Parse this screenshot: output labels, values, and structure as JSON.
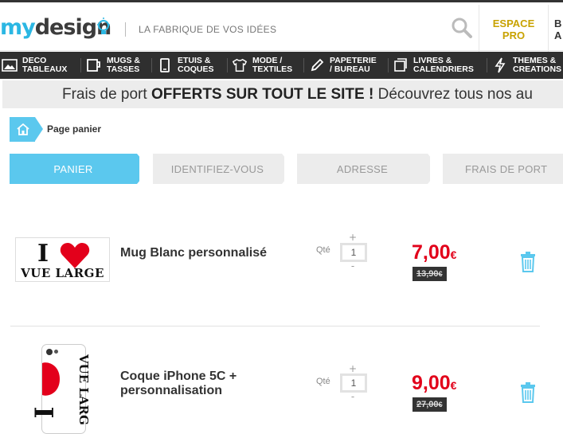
{
  "header": {
    "logo_my": "my",
    "logo_design": "design",
    "tagline": "LA FABRIQUE DE VOS IDÉES",
    "pro_line1": "ESPACE",
    "pro_line2": "PRO",
    "right_fragment_line1": "B",
    "right_fragment_line2": "A"
  },
  "nav": [
    {
      "line1": "DECO",
      "line2": "TABLEAUX",
      "icon": "frame-icon"
    },
    {
      "line1": "MUGS &",
      "line2": "TASSES",
      "icon": "mug-icon"
    },
    {
      "line1": "ETUIS &",
      "line2": "COQUES",
      "icon": "phone-icon"
    },
    {
      "line1": "MODE /",
      "line2": "TEXTILES",
      "icon": "tshirt-icon"
    },
    {
      "line1": "PAPETERIE",
      "line2": "/ BUREAU",
      "icon": "pencil-icon"
    },
    {
      "line1": "LIVRES &",
      "line2": "CALENDRIERS",
      "icon": "book-icon"
    },
    {
      "line1": "THEMES &",
      "line2": "CREATIONS",
      "icon": "lightning-icon"
    }
  ],
  "banner": {
    "prefix": "Frais de port ",
    "bold": "OFFERTS SUR TOUT LE SITE !",
    "suffix": "  Découvrez tous nos au"
  },
  "breadcrumb": {
    "label": "Page panier"
  },
  "steps": [
    "PANIER",
    "IDENTIFIEZ-VOUS",
    "ADRESSE",
    "FRAIS DE PORT"
  ],
  "cart": [
    {
      "name": "Mug Blanc personnalisé",
      "name_line2": "",
      "thumb_text_top": "I",
      "thumb_text_bottom": "VUE LARGE",
      "qty_label": "Qté",
      "qty": "1",
      "plus": "+",
      "minus": "-",
      "price": "7,00",
      "old_price": "13,90",
      "currency": "€"
    },
    {
      "name": "Coque iPhone 5C +",
      "name_line2": "personnalisation",
      "thumb_text_top": "I",
      "thumb_text_bottom": "VUE LARG",
      "qty_label": "Qté",
      "qty": "1",
      "plus": "+",
      "minus": "-",
      "price": "9,00",
      "old_price": "27,00",
      "currency": "€"
    }
  ],
  "colors": {
    "accent": "#5bc8ee",
    "price": "#e2001a",
    "pro": "#c8a200",
    "nav_bg": "#2f2f2f"
  }
}
